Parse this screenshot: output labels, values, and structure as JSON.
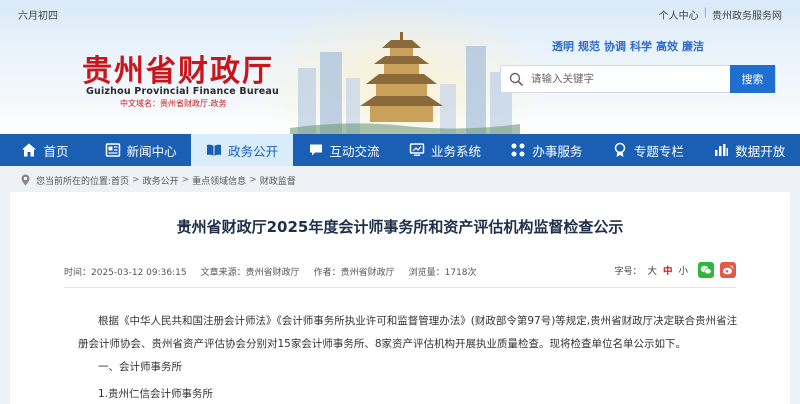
{
  "header": {
    "lunar_date": "六月初四",
    "top_links": [
      "个人中心",
      "贵州政务服务网"
    ],
    "top_sep": "|",
    "logo_cn": "贵州省财政厅",
    "logo_en": "Guizhou Provincial Finance Bureau",
    "logo_domain": "中文域名：贵州省财政厅.政务",
    "values": [
      "透明",
      "规范",
      "协调",
      "科学",
      "高效",
      "廉洁"
    ],
    "search": {
      "placeholder": "请输入关键字",
      "button": "搜索"
    }
  },
  "nav": {
    "items": [
      {
        "label": "首页",
        "icon": "home-icon"
      },
      {
        "label": "新闻中心",
        "icon": "news-icon"
      },
      {
        "label": "政务公开",
        "icon": "open-book-icon",
        "active": true
      },
      {
        "label": "互动交流",
        "icon": "chat-icon"
      },
      {
        "label": "业务系统",
        "icon": "monitor-icon"
      },
      {
        "label": "办事服务",
        "icon": "services-icon"
      },
      {
        "label": "专题专栏",
        "icon": "topic-icon"
      },
      {
        "label": "数据开放",
        "icon": "data-chart-icon"
      }
    ]
  },
  "breadcrumb": {
    "prefix": "您当前所在的位置:",
    "items": [
      "首页",
      "政务公开",
      "重点领域信息",
      "财政监督"
    ],
    "sep": ">"
  },
  "article": {
    "title": "贵州省财政厅2025年度会计师事务所和资产评估机构监督检查公示",
    "meta": {
      "time": "时间：2025-03-12 09:36:15",
      "source": "文章来源：贵州省财政厅",
      "author": "作者：贵州省财政厅",
      "views": "浏览量：1718次"
    },
    "font_size_label": "字号：",
    "font_sizes": [
      "大",
      "中",
      "小"
    ],
    "paragraph": "根据《中华人民共和国注册会计师法》《会计师事务所执业许可和监督管理办法》(财政部令第97号)等规定,贵州省财政厅决定联合贵州省注册会计师协会、贵州省资产评估协会分别对15家会计师事务所、8家资产评估机构开展执业质量检查。现将检查单位名单公示如下。",
    "section": "一、会计师事务所",
    "first_item": "1.贵州仁信会计师事务所"
  },
  "colors": {
    "brand_red": "#c8161d",
    "nav_blue": "#1a5fb4",
    "button_blue": "#1f6fd1",
    "wechat_green": "#2db83d",
    "weibo_red": "#e25a4a"
  }
}
